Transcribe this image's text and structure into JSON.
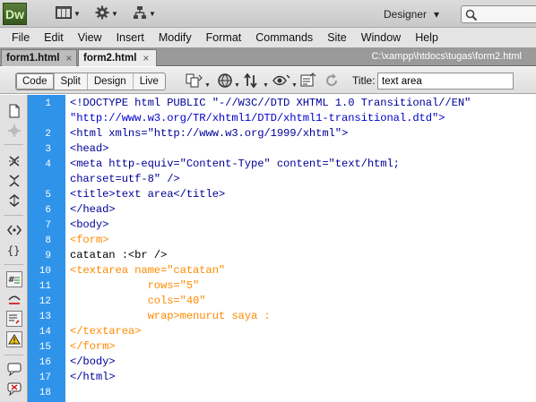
{
  "app": {
    "logo": "Dw",
    "workspace": "Designer",
    "workspace_caret": "▾"
  },
  "menu": [
    "File",
    "Edit",
    "View",
    "Insert",
    "Modify",
    "Format",
    "Commands",
    "Site",
    "Window",
    "Help"
  ],
  "tabs": [
    {
      "label": "form1.html",
      "close": "×"
    },
    {
      "label": "form2.html",
      "close": "×"
    }
  ],
  "document_path": "C:\\xampp\\htdocs\\tugas\\form2.html",
  "view_buttons": [
    "Code",
    "Split",
    "Design",
    "Live"
  ],
  "title_field": {
    "label": "Title:",
    "value": "text area"
  },
  "code_lines": [
    {
      "num": "1",
      "text": "<!DOCTYPE html PUBLIC \"-//W3C//DTD XHTML 1.0 Transitional//EN\""
    },
    {
      "num": "",
      "text": "\"http://www.w3.org/TR/xhtml1/DTD/xhtml1-transitional.dtd\">"
    },
    {
      "num": "2",
      "text": "<html xmlns=\"http://www.w3.org/1999/xhtml\">"
    },
    {
      "num": "3",
      "text": "<head>"
    },
    {
      "num": "4",
      "text": "<meta http-equiv=\"Content-Type\" content=\"text/html;"
    },
    {
      "num": "",
      "text": "charset=utf-8\" />"
    },
    {
      "num": "5",
      "text": "<title>text area</title>"
    },
    {
      "num": "6",
      "text": "</head>"
    },
    {
      "num": "7",
      "text": "<body>"
    },
    {
      "num": "8",
      "text": "<form>"
    },
    {
      "num": "9",
      "text": "catatan :<br />"
    },
    {
      "num": "10",
      "text": "<textarea name=\"catatan\""
    },
    {
      "num": "11",
      "text": "            rows=\"5\""
    },
    {
      "num": "12",
      "text": "            cols=\"40\""
    },
    {
      "num": "13",
      "text": "            wrap>menurut saya :"
    },
    {
      "num": "14",
      "text": "</textarea>"
    },
    {
      "num": "15",
      "text": "</form>"
    },
    {
      "num": "16",
      "text": "</body>"
    },
    {
      "num": "17",
      "text": "</html>"
    },
    {
      "num": "18",
      "text": ""
    }
  ],
  "colors": {
    "gutter": "#2f93ea",
    "tag": "#000099",
    "form_tag": "#ff8a00",
    "attr_value": "#0000cc"
  },
  "icons": {
    "app_bar": [
      "layout-icon",
      "gear-icon",
      "site-tree-icon",
      "search-icon"
    ],
    "doc_toolbar": [
      "file-management-icon",
      "preview-browser-icon",
      "refresh-design-icon",
      "visual-aids-icon",
      "validate-icon",
      "refresh-icon"
    ],
    "coding_toolbar": [
      "open-documents-icon",
      "show-code-navigator-icon",
      "collapse-tag-icon",
      "collapse-selection-icon",
      "expand-all-icon",
      "select-parent-tag-icon",
      "balance-braces-icon",
      "line-numbers-icon",
      "highlight-invalid-icon",
      "syntax-error-icon",
      "word-wrap-icon",
      "apply-comment-icon",
      "remove-comment-icon"
    ]
  }
}
